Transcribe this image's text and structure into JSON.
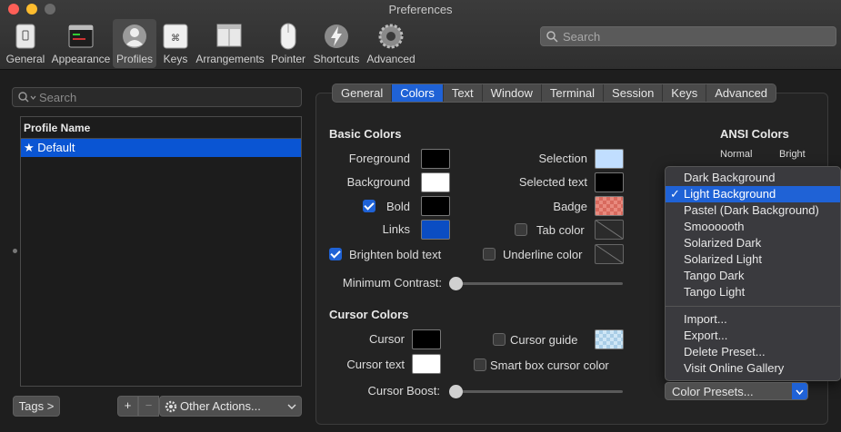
{
  "window": {
    "title": "Preferences"
  },
  "toolbar": {
    "items": [
      {
        "label": "General",
        "icon": "general-icon"
      },
      {
        "label": "Appearance",
        "icon": "appearance-icon"
      },
      {
        "label": "Profiles",
        "icon": "profiles-icon"
      },
      {
        "label": "Keys",
        "icon": "keys-icon"
      },
      {
        "label": "Arrangements",
        "icon": "arrangements-icon"
      },
      {
        "label": "Pointer",
        "icon": "pointer-icon"
      },
      {
        "label": "Shortcuts",
        "icon": "shortcuts-icon"
      },
      {
        "label": "Advanced",
        "icon": "advanced-icon"
      }
    ],
    "active": "Profiles",
    "search_placeholder": "Search"
  },
  "sidebar": {
    "search_placeholder": "Search",
    "column_header": "Profile Name",
    "profiles": [
      {
        "name": "Default",
        "star": "★"
      }
    ],
    "tags_label": "Tags >",
    "add_label": "+",
    "remove_label": "−",
    "other_actions_label": "Other Actions..."
  },
  "tabs": [
    "General",
    "Colors",
    "Text",
    "Window",
    "Terminal",
    "Session",
    "Keys",
    "Advanced"
  ],
  "active_tab": "Colors",
  "basic_colors": {
    "title": "Basic Colors",
    "foreground": "Foreground",
    "background": "Background",
    "bold": "Bold",
    "links": "Links",
    "brighten_bold": "Brighten bold text",
    "selection": "Selection",
    "selected_text": "Selected text",
    "badge": "Badge",
    "tab_color": "Tab color",
    "underline_color": "Underline color",
    "min_contrast": "Minimum Contrast:",
    "min_contrast_value": 0
  },
  "cursor_colors": {
    "title": "Cursor Colors",
    "cursor": "Cursor",
    "cursor_text": "Cursor text",
    "cursor_guide": "Cursor guide",
    "smart_box": "Smart box cursor color",
    "cursor_boost": "Cursor Boost:",
    "cursor_boost_value": 0
  },
  "ansi": {
    "title": "ANSI Colors",
    "normal": "Normal",
    "bright": "Bright"
  },
  "preset_menu": {
    "items": [
      "Dark Background",
      "Light Background",
      "Pastel (Dark Background)",
      "Smoooooth",
      "Solarized Dark",
      "Solarized Light",
      "Tango Dark",
      "Tango Light"
    ],
    "selected": "Light Background",
    "check": "✓",
    "actions": [
      "Import...",
      "Export...",
      "Delete Preset...",
      "Visit Online Gallery"
    ]
  },
  "color_presets_label": "Color Presets...",
  "colors": {
    "accent": "#1f62d6",
    "foreground": "#000000",
    "background": "#ffffff",
    "bold": "#000000",
    "links": "#0b4dc3",
    "selection": "#c1deff",
    "selected_text": "#000000",
    "cursor": "#000000",
    "cursor_text": "#ffffff"
  }
}
